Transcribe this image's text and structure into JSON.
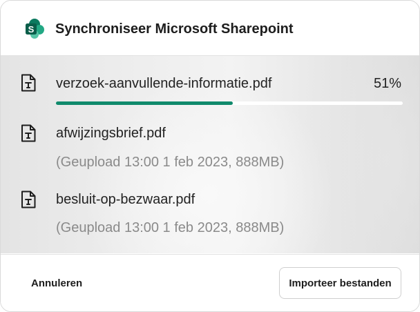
{
  "dialog": {
    "title": "Synchroniseer Microsoft Sharepoint",
    "app_icon": "sharepoint-icon",
    "brand_color": "#108a6c"
  },
  "files": [
    {
      "name": "verzoek-aanvullende-informatie.pdf",
      "icon": "pdf-file-icon",
      "progress_label": "51%",
      "progress": 0.51
    },
    {
      "name": "afwijzingsbrief.pdf",
      "icon": "pdf-file-icon",
      "meta": "(Geupload 13:00 1 feb 2023, 888MB)"
    },
    {
      "name": "besluit-op-bezwaar.pdf",
      "icon": "pdf-file-icon",
      "meta": "(Geupload 13:00 1 feb 2023, 888MB)"
    }
  ],
  "footer": {
    "cancel_label": "Annuleren",
    "import_label": "Importeer bestanden"
  }
}
